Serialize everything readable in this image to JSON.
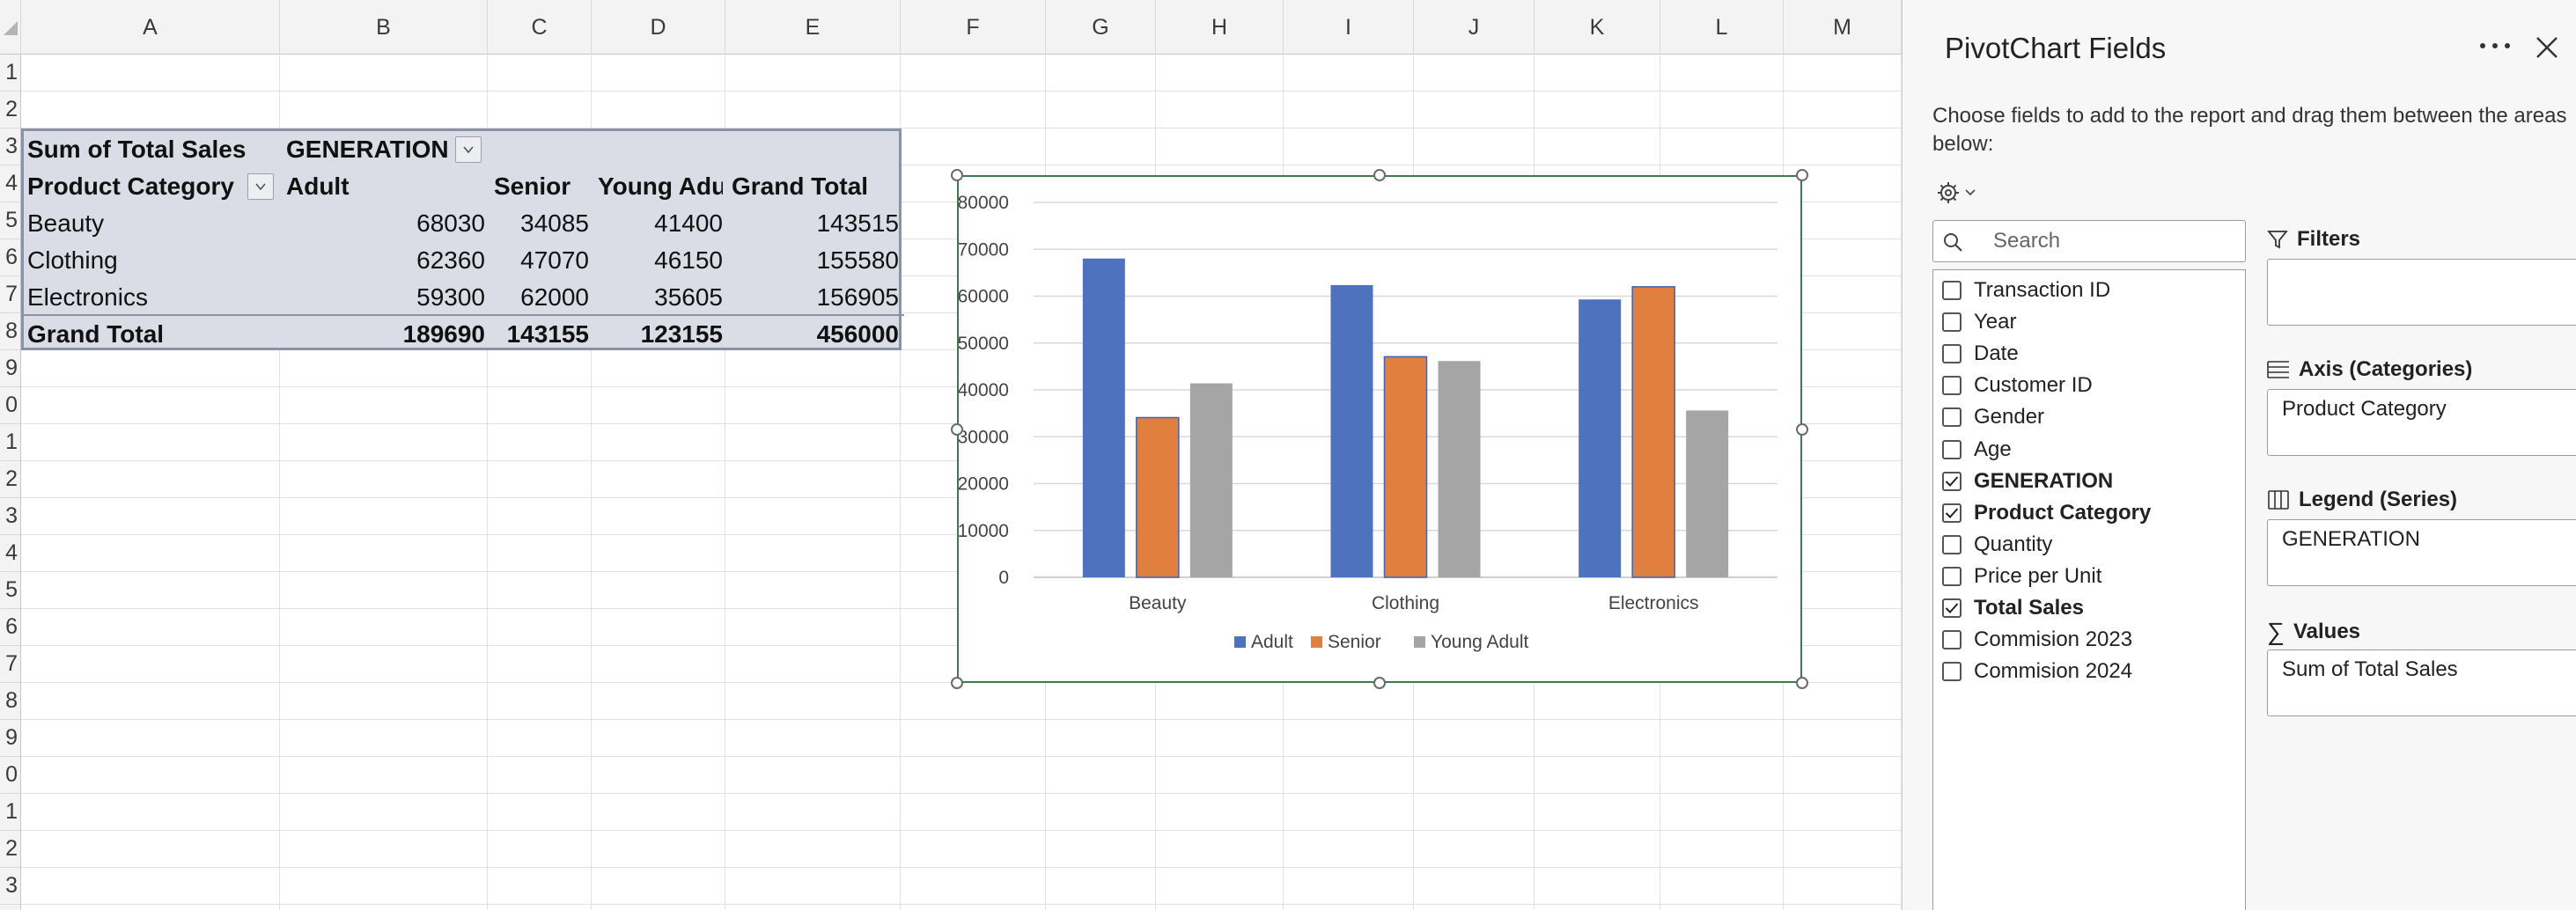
{
  "sheet": {
    "columns": [
      "A",
      "B",
      "C",
      "D",
      "E",
      "F",
      "G",
      "H",
      "I",
      "J",
      "K",
      "L",
      "M"
    ],
    "rows": [
      "1",
      "2",
      "3",
      "4",
      "5",
      "6",
      "7",
      "8",
      "9",
      "0",
      "1",
      "2",
      "3",
      "4",
      "5",
      "6",
      "7",
      "8",
      "9",
      "0",
      "1",
      "2",
      "3"
    ]
  },
  "pivot": {
    "values_label": "Sum of Total Sales",
    "column_field": "GENERATION",
    "row_field": "Product Category",
    "headers": [
      "Adult",
      "Senior",
      "Young Adult",
      "Grand Total"
    ],
    "rows": [
      {
        "label": "Beauty",
        "values": [
          "68030",
          "34085",
          "41400",
          "143515"
        ]
      },
      {
        "label": "Clothing",
        "values": [
          "62360",
          "47070",
          "46150",
          "155580"
        ]
      },
      {
        "label": "Electronics",
        "values": [
          "59300",
          "62000",
          "35605",
          "156905"
        ]
      }
    ],
    "grand_total": {
      "label": "Grand Total",
      "values": [
        "189690",
        "143155",
        "123155",
        "456000"
      ]
    }
  },
  "chart_data": {
    "type": "bar",
    "categories": [
      "Beauty",
      "Clothing",
      "Electronics"
    ],
    "series": [
      {
        "name": "Adult",
        "values": [
          68030,
          62360,
          59300
        ],
        "color": "#4f72be"
      },
      {
        "name": "Senior",
        "values": [
          34085,
          47070,
          62000
        ],
        "color": "#e07f3e"
      },
      {
        "name": "Young Adult",
        "values": [
          41400,
          46150,
          35605
        ],
        "color": "#a5a5a5"
      }
    ],
    "ylim": [
      0,
      80000
    ],
    "yticks": [
      "80000",
      "70000",
      "60000",
      "50000",
      "40000",
      "30000",
      "20000",
      "10000",
      "0"
    ],
    "legend_position": "bottom",
    "grid": true
  },
  "pane": {
    "title": "PivotChart Fields",
    "description": "Choose fields to add to the report and drag them between the areas below:",
    "search_placeholder": "Search",
    "fields": [
      {
        "label": "Transaction ID",
        "checked": false
      },
      {
        "label": "Year",
        "checked": false
      },
      {
        "label": "Date",
        "checked": false
      },
      {
        "label": "Customer ID",
        "checked": false
      },
      {
        "label": "Gender",
        "checked": false
      },
      {
        "label": "Age",
        "checked": false
      },
      {
        "label": "GENERATION",
        "checked": true
      },
      {
        "label": "Product Category",
        "checked": true
      },
      {
        "label": "Quantity",
        "checked": false
      },
      {
        "label": "Price per Unit",
        "checked": false
      },
      {
        "label": "Total Sales",
        "checked": true
      },
      {
        "label": "Commision 2023",
        "checked": false
      },
      {
        "label": "Commision 2024",
        "checked": false
      }
    ],
    "areas": {
      "filters": {
        "title": "Filters",
        "items": []
      },
      "axis": {
        "title": "Axis (Categories)",
        "items": [
          "Product Category"
        ]
      },
      "legend": {
        "title": "Legend (Series)",
        "items": [
          "GENERATION"
        ]
      },
      "values": {
        "title": "Values",
        "items": [
          "Sum of Total Sales"
        ]
      }
    }
  }
}
